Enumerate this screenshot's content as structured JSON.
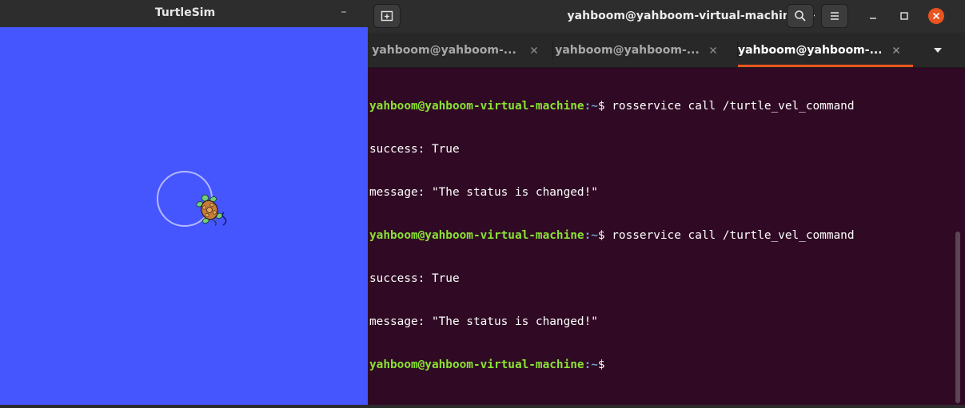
{
  "turtlesim": {
    "title": "TurtleSim",
    "minimize_glyph": "–",
    "background_color": "#4556ff",
    "pen_color": "#b3b8ff"
  },
  "terminal": {
    "title": "yahboom@yahboom-virtual-machine: ~",
    "new_tab_icon": "new-tab-icon",
    "search_icon": "search-icon",
    "menu_icon": "hamburger-menu-icon",
    "tabs": [
      {
        "label": "yahboom@yahboom-...",
        "active": false
      },
      {
        "label": "yahboom@yahboom-...",
        "active": false
      },
      {
        "label": "yahboom@yahboom-...",
        "active": true
      }
    ],
    "accent_color": "#e95420",
    "background_color": "#300a24",
    "lines": [
      {
        "user": "yahboom@yahboom-virtual-machine",
        "path": ":~",
        "cmd": "$ rosservice call /turtle_vel_command"
      },
      {
        "text": "success: True"
      },
      {
        "text": "message: \"The status is changed!\""
      },
      {
        "user": "yahboom@yahboom-virtual-machine",
        "path": ":~",
        "cmd": "$ rosservice call /turtle_vel_command"
      },
      {
        "text": "success: True"
      },
      {
        "text": "message: \"The status is changed!\""
      },
      {
        "user": "yahboom@yahboom-virtual-machine",
        "path": ":~",
        "cmd": "$"
      }
    ]
  }
}
